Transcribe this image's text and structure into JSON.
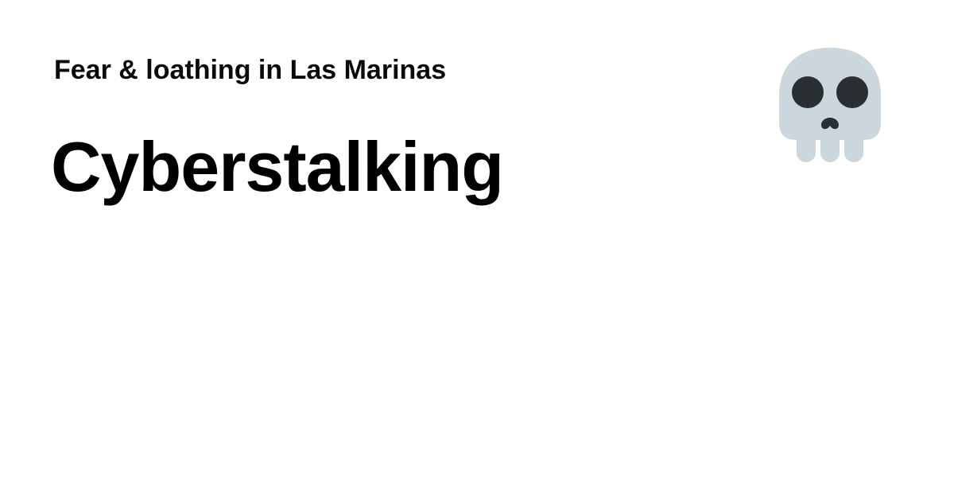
{
  "header": {
    "site_name": "Fear & loathing in Las Marinas"
  },
  "main": {
    "title": "Cyberstalking",
    "emoji": {
      "icon": "skull-icon",
      "bone_color": "#CCD6DD",
      "socket_color": "#292F33"
    }
  }
}
